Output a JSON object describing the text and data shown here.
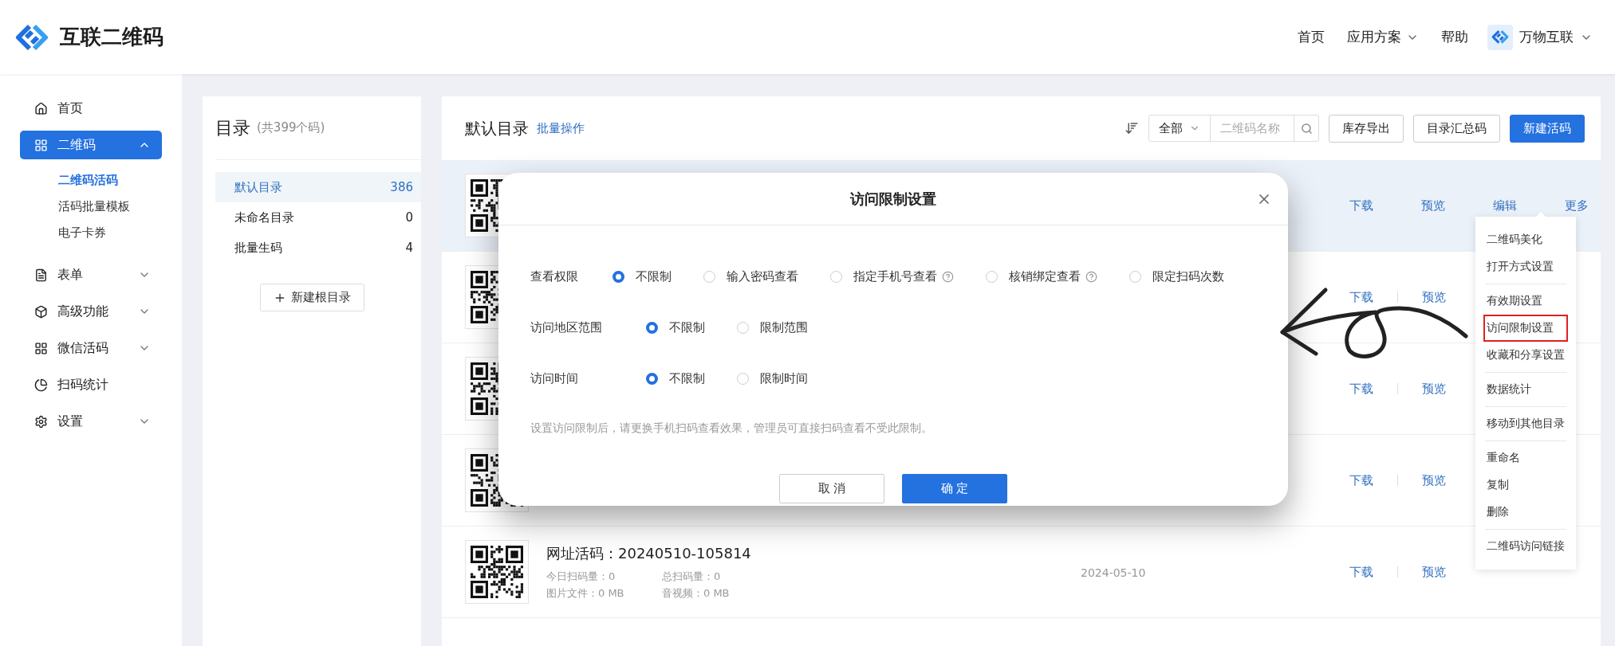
{
  "header": {
    "logo_text": "互联二维码",
    "nav": [
      {
        "label": "首页",
        "dropdown": false
      },
      {
        "label": "应用方案",
        "dropdown": true
      },
      {
        "label": "帮助",
        "dropdown": false
      }
    ],
    "user": {
      "name": "万物互联"
    }
  },
  "sidebar": {
    "items": [
      {
        "label": "首页",
        "selected": false
      },
      {
        "label": "二维码",
        "selected": true,
        "expanded": true,
        "children": [
          {
            "label": "二维码活码",
            "selected": true
          },
          {
            "label": "活码批量模板",
            "selected": false
          },
          {
            "label": "电子卡券",
            "selected": false
          }
        ]
      },
      {
        "label": "表单",
        "selected": false,
        "expanded": false
      },
      {
        "label": "高级功能",
        "selected": false,
        "expanded": false
      },
      {
        "label": "微信活码",
        "selected": false,
        "expanded": false
      },
      {
        "label": "扫码统计",
        "selected": false
      },
      {
        "label": "设置",
        "selected": false,
        "expanded": false
      }
    ]
  },
  "catalog": {
    "title": "目录",
    "count": "(共399个码)",
    "folders": [
      {
        "name": "默认目录",
        "count": "386",
        "selected": true
      },
      {
        "name": "未命名目录",
        "count": "0",
        "selected": false
      },
      {
        "name": "批量生码",
        "count": "4",
        "selected": false
      }
    ],
    "new_button": "新建根目录"
  },
  "main": {
    "title": "默认目录",
    "batch_link": "批量操作",
    "filter": {
      "value": "全部"
    },
    "search": {
      "placeholder": "二维码名称"
    },
    "buttons": [
      {
        "label": "库存导出",
        "kind": "default"
      },
      {
        "label": "目录汇总码",
        "kind": "default"
      },
      {
        "label": "新建活码",
        "kind": "primary"
      }
    ],
    "rows": [
      {
        "highlighted": true,
        "actions": [
          "下载",
          "预览",
          "编辑",
          "更多"
        ]
      },
      {
        "highlighted": false,
        "actions": [
          "下载",
          "预览"
        ]
      },
      {
        "highlighted": false,
        "actions": [
          "下载",
          "预览"
        ]
      },
      {
        "highlighted": false,
        "actions": [
          "下载",
          "预览"
        ]
      },
      {
        "highlighted": false,
        "title": "网址活码：20240510-105814",
        "stats": [
          "今日扫码量：0",
          "总扫码量：0",
          "图片文件：0 MB",
          "音视频：0 MB"
        ],
        "date": "2024-05-10",
        "actions": [
          "下载",
          "预览"
        ]
      }
    ]
  },
  "dialog": {
    "title": "访问限制设置",
    "settings": [
      {
        "label": "查看权限",
        "options": [
          {
            "label": "不限制",
            "selected": true,
            "help": false
          },
          {
            "label": "输入密码查看",
            "selected": false,
            "help": false
          },
          {
            "label": "指定手机号查看",
            "selected": false,
            "help": true
          },
          {
            "label": "核销绑定查看",
            "selected": false,
            "help": true
          },
          {
            "label": "限定扫码次数",
            "selected": false,
            "help": false
          }
        ]
      },
      {
        "label": "访问地区范围",
        "options": [
          {
            "label": "不限制",
            "selected": true,
            "help": false
          },
          {
            "label": "限制范围",
            "selected": false,
            "help": false
          }
        ]
      },
      {
        "label": "访问时间",
        "options": [
          {
            "label": "不限制",
            "selected": true,
            "help": false
          },
          {
            "label": "限制时间",
            "selected": false,
            "help": false
          }
        ]
      }
    ],
    "note": "设置访问限制后，请更换手机扫码查看效果，管理员可直接扫码查看不受此限制。",
    "buttons": [
      {
        "label": "取 消",
        "kind": "default"
      },
      {
        "label": "确 定",
        "kind": "primary"
      }
    ]
  },
  "menu": {
    "groups": [
      [
        {
          "label": "二维码美化",
          "highlighted": false
        },
        {
          "label": "打开方式设置",
          "highlighted": false
        }
      ],
      [
        {
          "label": "有效期设置",
          "highlighted": false
        },
        {
          "label": "访问限制设置",
          "highlighted": true
        },
        {
          "label": "收藏和分享设置",
          "highlighted": false
        }
      ],
      [
        {
          "label": "数据统计",
          "highlighted": false
        }
      ],
      [
        {
          "label": "移动到其他目录",
          "highlighted": false
        }
      ],
      [
        {
          "label": "重命名",
          "highlighted": false
        },
        {
          "label": "复制",
          "highlighted": false
        },
        {
          "label": "删除",
          "highlighted": false
        }
      ],
      [
        {
          "label": "二维码访问链接",
          "highlighted": false
        }
      ]
    ]
  }
}
